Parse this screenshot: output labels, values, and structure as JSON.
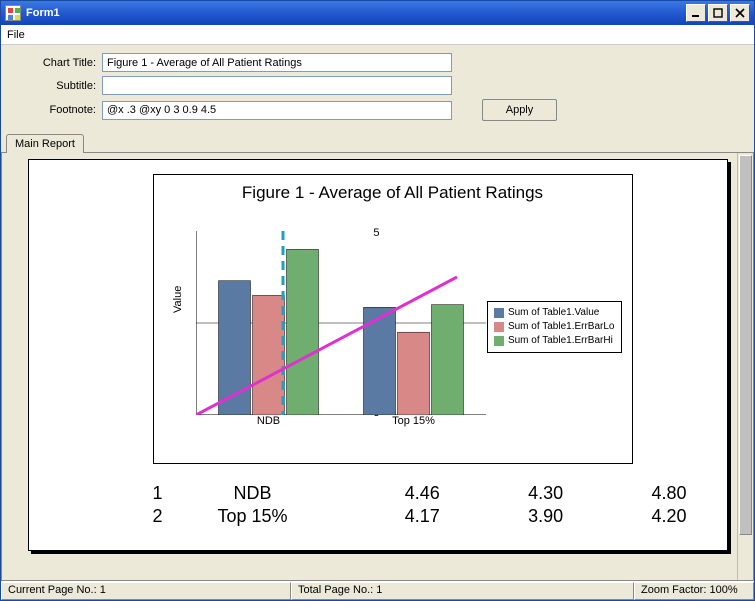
{
  "window": {
    "title": "Form1"
  },
  "menu": {
    "file": "File"
  },
  "form": {
    "chart_title_label": "Chart Title:",
    "chart_title_value": "Figure 1 - Average of All Patient Ratings",
    "subtitle_label": "Subtitle:",
    "subtitle_value": "",
    "footnote_label": "Footnote:",
    "footnote_value": "@x .3 @xy 0 3 0.9 4.5",
    "apply_label": "Apply"
  },
  "tabs": {
    "main": "Main Report"
  },
  "chart_data": {
    "type": "bar",
    "title": "Figure 1 - Average of All Patient Ratings",
    "ylabel": "Value",
    "ylim": [
      3.0,
      5.0
    ],
    "yticks": [
      3.0,
      4.0,
      5.0
    ],
    "categories": [
      "NDB",
      "Top 15%"
    ],
    "series": [
      {
        "name": "Sum of Table1.Value",
        "color": "#5A7AA3",
        "values": [
          4.46,
          4.17
        ]
      },
      {
        "name": "Sum of Table1.ErrBarLo",
        "color": "#D98888",
        "values": [
          4.3,
          3.9
        ]
      },
      {
        "name": "Sum of Table1.ErrBarHi",
        "color": "#6FAE6F",
        "values": [
          4.8,
          4.2
        ]
      }
    ],
    "trend_line": {
      "x1": 0.0,
      "y1": 3.0,
      "x2": 0.9,
      "y2": 4.5,
      "color": "#E030D0"
    },
    "ref_line": {
      "x": 0.3,
      "color": "#20A0C0",
      "dash": true
    }
  },
  "table": {
    "rows": [
      {
        "idx": "1",
        "cat": "NDB",
        "v": "4.46",
        "lo": "4.30",
        "hi": "4.80"
      },
      {
        "idx": "2",
        "cat": "Top 15%",
        "v": "4.17",
        "lo": "3.90",
        "hi": "4.20"
      }
    ]
  },
  "status": {
    "current_page": "Current Page No.: 1",
    "total_page": "Total Page No.: 1",
    "zoom": "Zoom Factor: 100%"
  }
}
